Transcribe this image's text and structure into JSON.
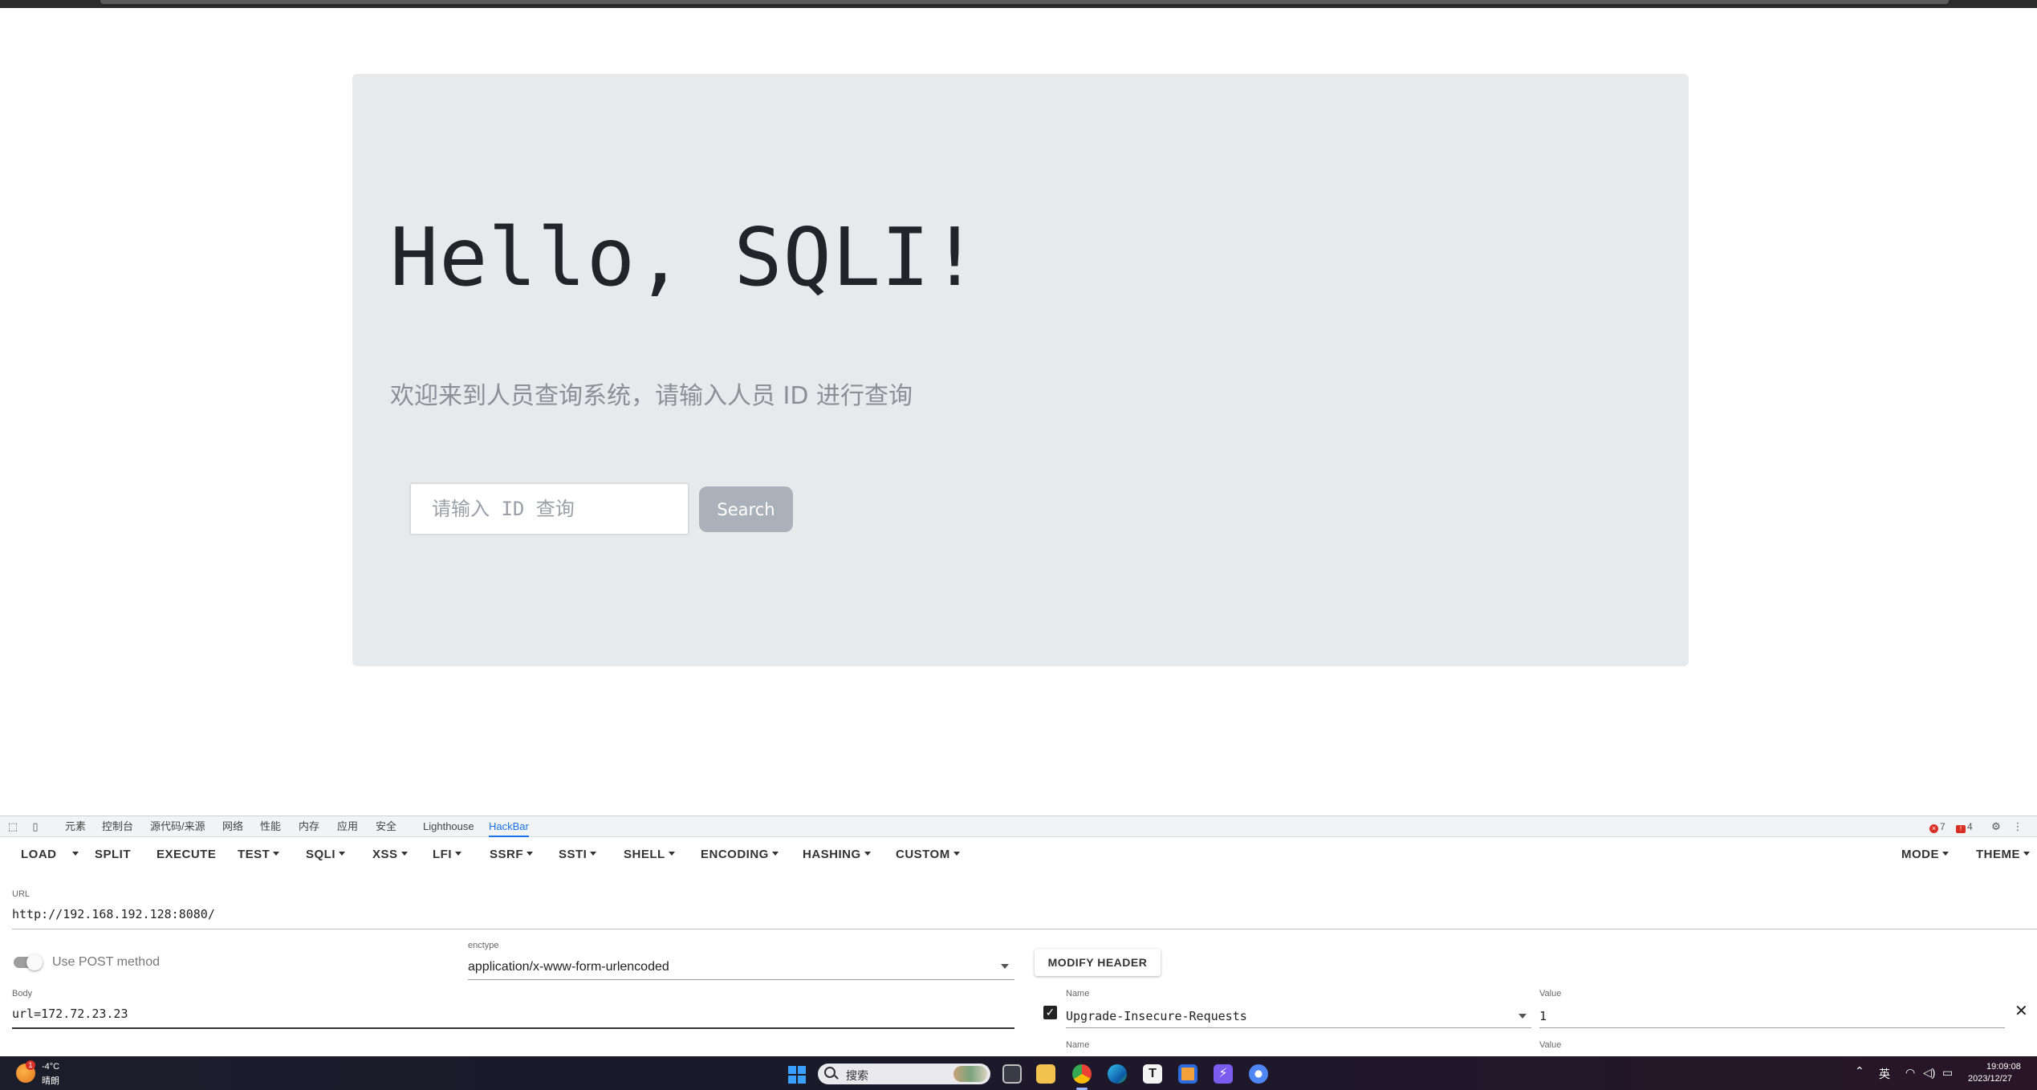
{
  "page": {
    "heading": "Hello, SQLI!",
    "subtitle": "欢迎来到人员查询系统，请输入人员 ID 进行查询",
    "search_placeholder": "请输入 ID 查询",
    "search_button": "Search"
  },
  "devtools": {
    "tabs": [
      "元素",
      "控制台",
      "源代码/来源",
      "网络",
      "性能",
      "内存",
      "应用",
      "安全",
      "Lighthouse",
      "HackBar"
    ],
    "active_tab": "HackBar",
    "error_count": "7",
    "warning_count": "4"
  },
  "hackbar": {
    "toolbar": {
      "load": "LOAD",
      "split": "SPLIT",
      "execute": "EXECUTE",
      "test": "TEST",
      "sqli": "SQLI",
      "xss": "XSS",
      "lfi": "LFI",
      "ssrf": "SSRF",
      "ssti": "SSTI",
      "shell": "SHELL",
      "encoding": "ENCODING",
      "hashing": "HASHING",
      "custom": "CUSTOM",
      "mode": "MODE",
      "theme": "THEME"
    },
    "url_label": "URL",
    "url_value": "http://192.168.192.128:8080/",
    "post_label": "Use POST method",
    "post_enabled": true,
    "enctype_label": "enctype",
    "enctype_value": "application/x-www-form-urlencoded",
    "modify_header": "MODIFY HEADER",
    "body_label": "Body",
    "body_value": "url=172.72.23.23",
    "header_name_label": "Name",
    "header_value_label": "Value",
    "header_name": "Upgrade-Insecure-Requests",
    "header_value": "1",
    "header_enabled": true
  },
  "taskbar": {
    "weather_badge": "1",
    "weather_temp": "-4°C",
    "weather_desc": "晴朗",
    "search_text": "搜索",
    "ime": "英",
    "time": "19:09:08",
    "date": "2023/12/27",
    "apps": [
      "task-view-icon",
      "file-explorer-icon",
      "chrome-icon",
      "edge-icon",
      "typora-icon",
      "app-icon",
      "vscode-icon",
      "chrome-dev-icon"
    ]
  },
  "colors": {
    "jumbotron_bg": "#e7eaed",
    "search_button_bg": "#aab1b8",
    "active_tab": "#1a73e8",
    "error": "#d93025"
  }
}
